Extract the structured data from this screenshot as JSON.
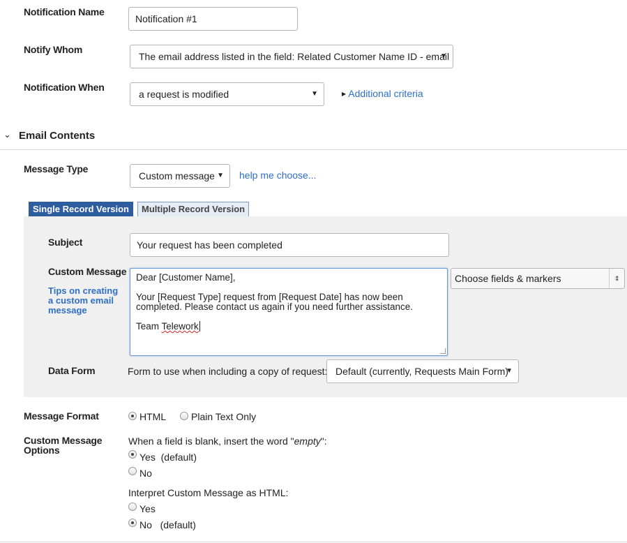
{
  "notification": {
    "name_label": "Notification Name",
    "name_value": "Notification #1",
    "whom_label": "Notify Whom",
    "whom_value": "The email address listed in the field: Related Customer Name ID - email",
    "when_label": "Notification When",
    "when_value": "a request is modified",
    "additional_criteria": "Additional criteria"
  },
  "email_section": {
    "title": "Email Contents",
    "message_type_label": "Message Type",
    "message_type_value": "Custom message",
    "help_link": "help me choose...",
    "tabs": [
      {
        "label": "Single Record Version",
        "active": true
      },
      {
        "label": "Multiple Record Version",
        "active": false
      }
    ],
    "subject_label": "Subject",
    "subject_value": "Your request has been completed",
    "custom_message_label": "Custom Message",
    "tips_link": [
      "Tips on creating",
      "a custom email",
      "message"
    ],
    "message_lines": {
      "greeting": "Dear [Customer Name],",
      "body_1": "Your [Request Type] request from [Request Date] has now been",
      "body_2": "completed.  Please contact us again if you need further assistance.",
      "sign_prefix": "Team ",
      "sign_word": "Telework"
    },
    "fields_select": "Choose fields & markers",
    "data_form_label": "Data Form",
    "data_form_desc": "Form to use when including a copy of request:",
    "data_form_value": "Default (currently, Requests Main Form)"
  },
  "format": {
    "label": "Message Format",
    "html": "HTML",
    "plain": "Plain Text Only",
    "selected": "HTML"
  },
  "options": {
    "label_1": "Custom Message",
    "label_2": "Options",
    "blank_prefix": "When a field is blank, insert the word \"",
    "blank_word": "empty",
    "blank_suffix": "\":",
    "blank_yes": "Yes",
    "blank_yes_note": "(default)",
    "blank_no": "No",
    "blank_selected": "Yes",
    "html_question": "Interpret Custom Message as HTML:",
    "html_yes": "Yes",
    "html_no": "No",
    "html_no_note": "(default)",
    "html_selected": "No"
  },
  "colors": {
    "accent_link": "#2f6fc4",
    "tab_active": "#2e5d9f",
    "panel_bg": "#f0f0f0"
  }
}
